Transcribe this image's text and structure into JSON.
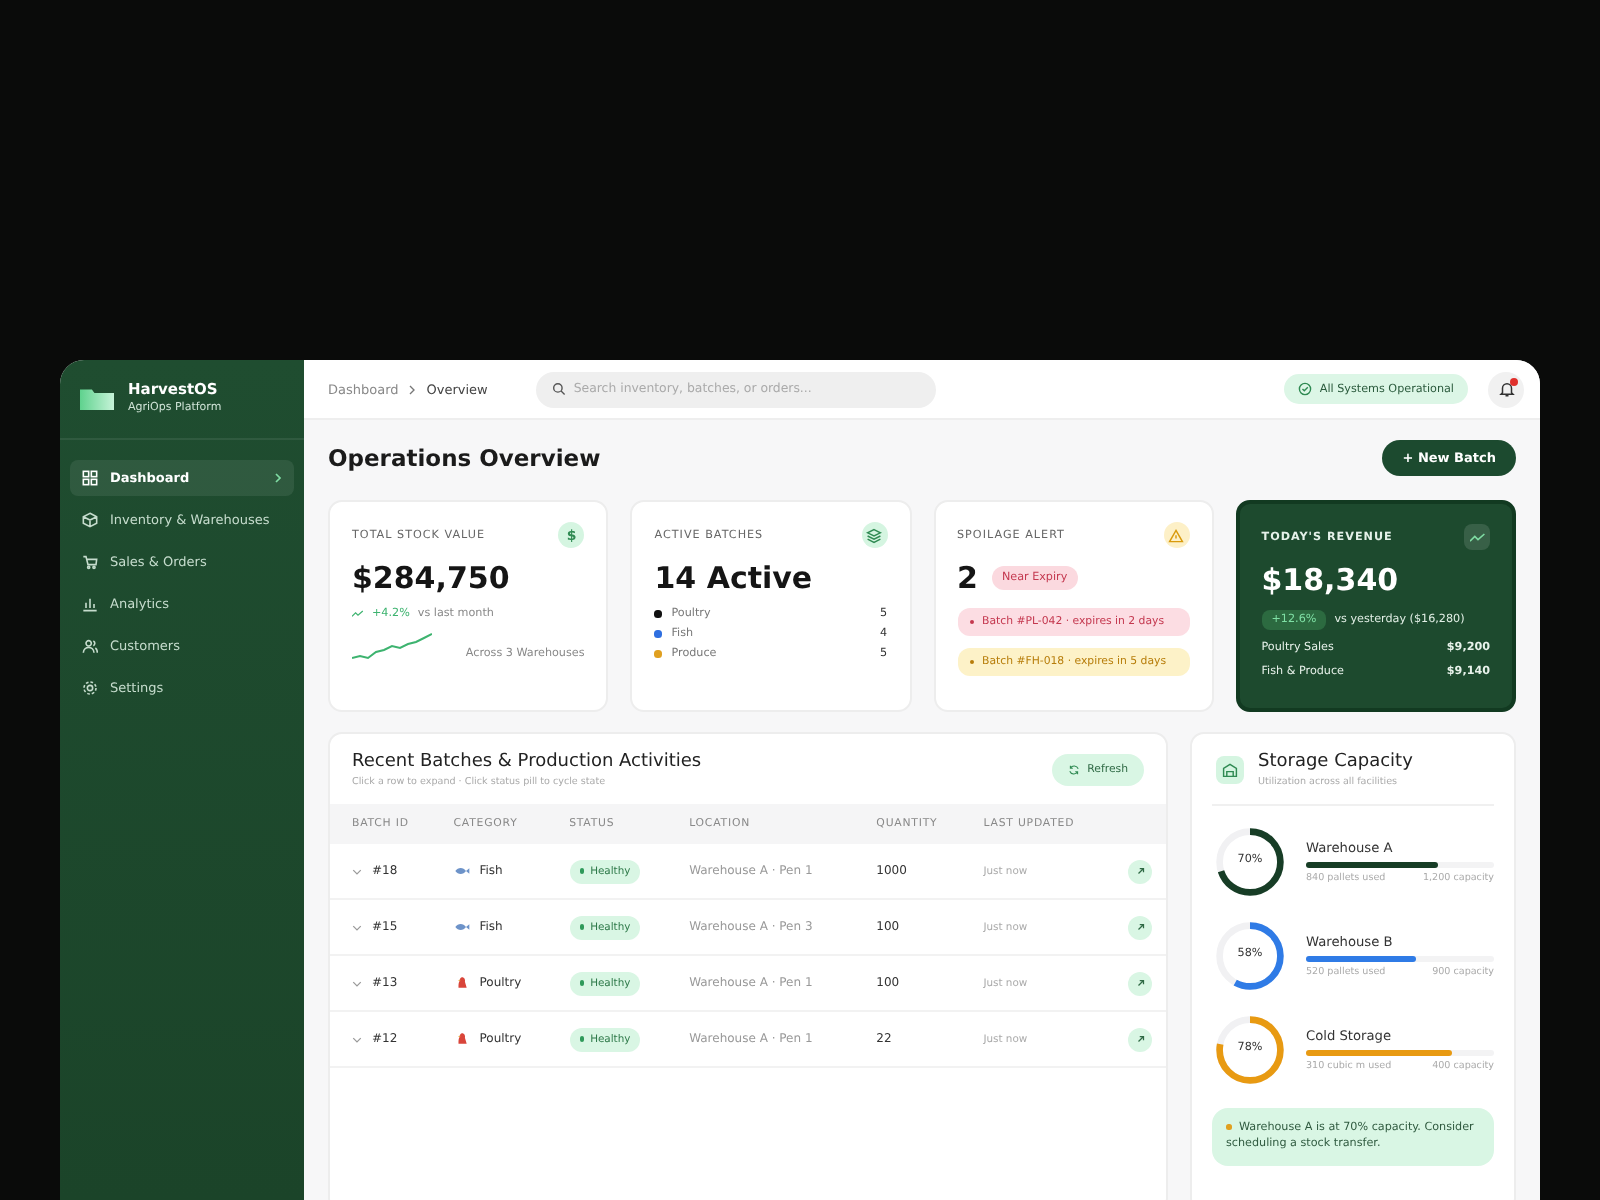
{
  "sidebar": {
    "brand": "HarvestOS",
    "subtitle": "AgriOps Platform",
    "items": [
      {
        "label": "Dashboard",
        "selected": true
      },
      {
        "label": "Inventory & Warehouses",
        "selected": false
      },
      {
        "label": "Sales & Orders",
        "selected": false
      },
      {
        "label": "Analytics",
        "selected": false
      },
      {
        "label": "Customers",
        "selected": false
      },
      {
        "label": "Settings",
        "selected": false
      }
    ]
  },
  "topbar": {
    "breadcrumb": [
      "Dashboard",
      "Overview"
    ],
    "search": {
      "placeholder": "Search inventory, batches, or orders..."
    },
    "status": "All Systems Operational",
    "notification": true
  },
  "page": {
    "title": "Operations Overview",
    "new_button": "+ New Batch"
  },
  "stock_card": {
    "label": "TOTAL STOCK VALUE",
    "icon": "$",
    "value": "$284,750",
    "change": "+4.2%",
    "change_note": "vs last month",
    "footnote": "Across 3 Warehouses"
  },
  "batches_card": {
    "label": "ACTIVE BATCHES",
    "value": "14 Active",
    "items": [
      {
        "name": "Poultry",
        "count": "5",
        "color": "#111111"
      },
      {
        "name": "Fish",
        "count": "4",
        "color": "#2f6fe0"
      },
      {
        "name": "Produce",
        "count": "5",
        "color": "#e0a020"
      }
    ]
  },
  "spoilage_card": {
    "label": "SPOILAGE ALERT",
    "count": "2",
    "badge": "Near Expiry",
    "alerts": [
      {
        "kind": "critical",
        "text": "Batch #PL-042 · expires in 2 days"
      },
      {
        "kind": "warning",
        "text": "Batch #FH-018 · expires in 5 days"
      }
    ]
  },
  "revenue_card": {
    "label": "TODAY'S REVENUE",
    "value": "$18,340",
    "change": "+12.6%",
    "change_note": "vs yesterday ($16,280)",
    "rows": [
      {
        "name": "Poultry Sales",
        "amount": "$9,200"
      },
      {
        "name": "Fish & Produce",
        "amount": "$9,140"
      }
    ]
  },
  "table": {
    "title": "Recent Batches & Production Activities",
    "hint": "Click a row to expand · Click status pill to cycle state",
    "refresh": "Refresh",
    "columns": [
      "BATCH ID",
      "CATEGORY",
      "STATUS",
      "LOCATION",
      "QUANTITY",
      "LAST UPDATED"
    ],
    "rows": [
      {
        "id": "#18",
        "kind": "fish",
        "category": "Fish",
        "status": "Healthy",
        "location": "Warehouse A · Pen 1",
        "quantity": "1000",
        "updated": "Just now"
      },
      {
        "id": "#15",
        "kind": "fish",
        "category": "Fish",
        "status": "Healthy",
        "location": "Warehouse A · Pen 3",
        "quantity": "100",
        "updated": "Just now"
      },
      {
        "id": "#13",
        "kind": "poultry",
        "category": "Poultry",
        "status": "Healthy",
        "location": "Warehouse A · Pen 1",
        "quantity": "100",
        "updated": "Just now"
      },
      {
        "id": "#12",
        "kind": "poultry",
        "category": "Poultry",
        "status": "Healthy",
        "location": "Warehouse A · Pen 1",
        "quantity": "22",
        "updated": "Just now"
      }
    ]
  },
  "storage": {
    "title": "Storage Capacity",
    "subtitle": "Utilization across all facilities",
    "facilities": [
      {
        "name": "Warehouse A",
        "percent": "70%",
        "level": 0.7,
        "used": "840 pallets used",
        "capacity": "1,200 capacity",
        "color": "#173d26"
      },
      {
        "name": "Warehouse B",
        "percent": "58%",
        "level": 0.58,
        "used": "520 pallets used",
        "capacity": "900 capacity",
        "color": "#2f7be6"
      },
      {
        "name": "Cold Storage",
        "percent": "78%",
        "level": 0.78,
        "used": "310 cubic m used",
        "capacity": "400 capacity",
        "color": "#e89a12"
      }
    ],
    "note": "Warehouse A is at 70% capacity. Consider scheduling a stock transfer."
  }
}
